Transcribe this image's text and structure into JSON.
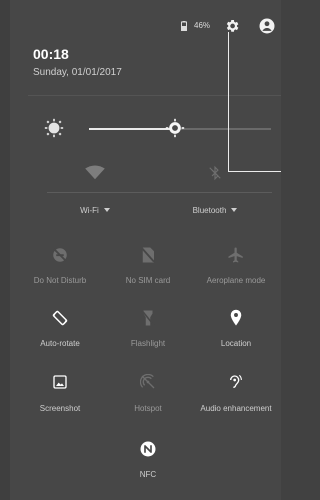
{
  "status_bar": {
    "battery": "46%"
  },
  "header": {
    "time": "00:18",
    "date": "Sunday, 01/01/2017"
  },
  "brightness": {
    "level_percent": 47
  },
  "connectivity": {
    "wifi_label": "Wi-Fi",
    "bluetooth_label": "Bluetooth"
  },
  "tiles": {
    "dnd": "Do Not Disturb",
    "no_sim": "No SIM card",
    "aeroplane": "Aeroplane mode",
    "auto_rotate": "Auto-rotate",
    "flashlight": "Flashlight",
    "location": "Location",
    "screenshot": "Screenshot",
    "hotspot": "Hotspot",
    "audio": "Audio enhancement",
    "nfc": "NFC"
  },
  "colors": {
    "background": "#474747",
    "active_icon": "#ffffff",
    "inactive_icon": "#7d7d7d"
  }
}
